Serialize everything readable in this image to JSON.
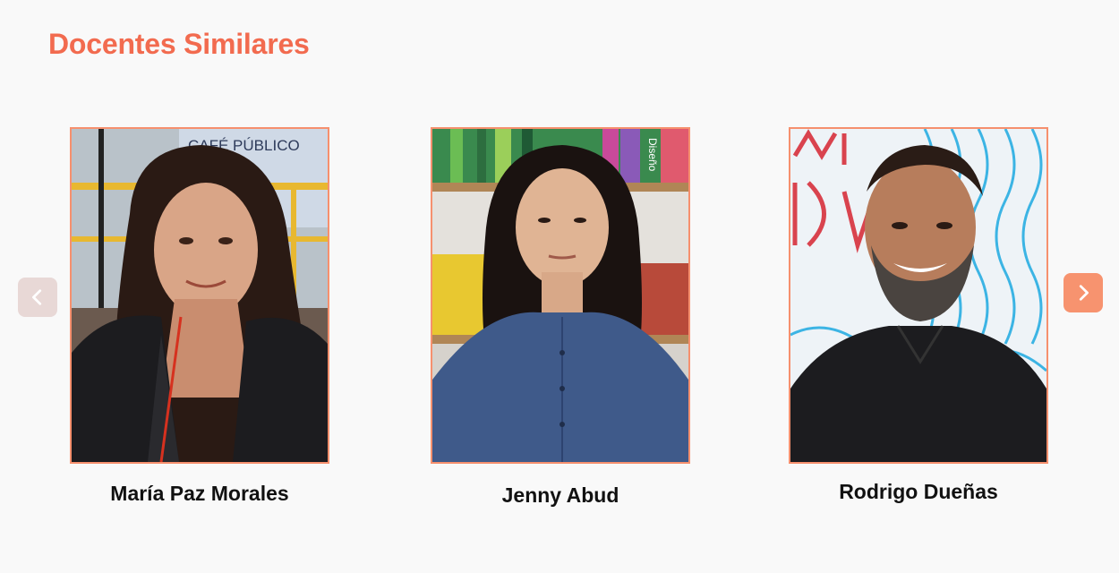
{
  "section": {
    "title": "Docentes Similares"
  },
  "carousel": {
    "prev_icon": "chevron-left-icon",
    "next_icon": "chevron-right-icon",
    "cards": [
      {
        "name": "María Paz Morales",
        "sign_text": "CAFÉ PÚBLICO"
      },
      {
        "name": "Jenny Abud",
        "book_text": "Diseño"
      },
      {
        "name": "Rodrigo Dueñas"
      }
    ]
  },
  "colors": {
    "accent": "#f26b4f",
    "frame": "#f6906e",
    "next_button": "#f7936f",
    "prev_button": "#e8d8d6",
    "background": "#f9f9f9"
  }
}
